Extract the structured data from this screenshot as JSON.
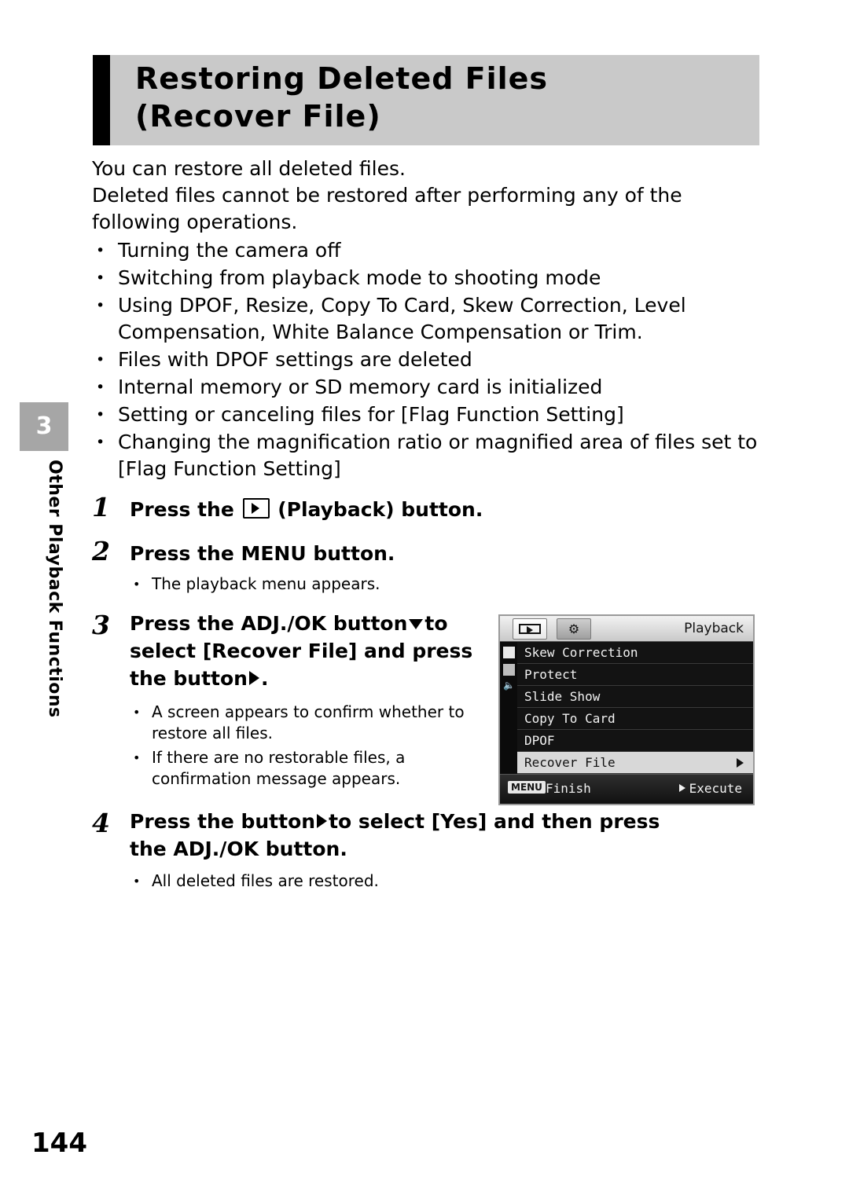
{
  "header": {
    "title_line1": "Restoring Deleted Files",
    "title_line2": "(Recover File)"
  },
  "chapter": {
    "number": "3",
    "vertical_label": "Other Playback Functions"
  },
  "intro": {
    "line1": "You can restore all deleted files.",
    "line2": "Deleted files cannot be restored after performing any of the following operations."
  },
  "conditions": [
    "Turning the camera off",
    "Switching from playback mode to shooting mode",
    "Using DPOF, Resize, Copy To Card, Skew Correction, Level Compensation, White Balance Compensation or Trim.",
    "Files with DPOF settings are deleted",
    "Internal memory or SD memory card is initialized",
    "Setting or canceling files for [Flag Function Setting]",
    "Changing the magnification ratio or magnified area of files set to [Flag Function Setting]"
  ],
  "steps": {
    "s1": {
      "num": "1",
      "text_before": "Press the",
      "text_after": "(Playback) button."
    },
    "s2": {
      "num": "2",
      "text": "Press the MENU button.",
      "note": "The playback menu appears."
    },
    "s3": {
      "num": "3",
      "line1_a": "Press the ADJ./OK button",
      "line1_b": "to",
      "line2": "select [Recover File] and press",
      "line3_a": "the button",
      "line3_b": ".",
      "note1": "A screen appears to confirm whether to restore all files.",
      "note2": "If there are no restorable files, a confirmation message appears."
    },
    "s4": {
      "num": "4",
      "line1_a": "Press the button",
      "line1_b": "to select",
      "line2": "[Yes] and then press the ADJ./OK button.",
      "note": "All deleted files are restored."
    }
  },
  "lcd": {
    "title": "Playback",
    "tab1_icon": "playback-icon",
    "tab2_icon": "setup-wrench-icon",
    "menu_items": [
      {
        "label": "Skew Correction",
        "selected": false
      },
      {
        "label": "Protect",
        "selected": false
      },
      {
        "label": "Slide Show",
        "selected": false
      },
      {
        "label": "Copy To Card",
        "selected": false
      },
      {
        "label": "DPOF",
        "selected": false
      },
      {
        "label": "Recover File",
        "selected": true
      }
    ],
    "menu_chip": "MENU",
    "finish_label": "Finish",
    "execute_label": "Execute"
  },
  "page_number": "144"
}
